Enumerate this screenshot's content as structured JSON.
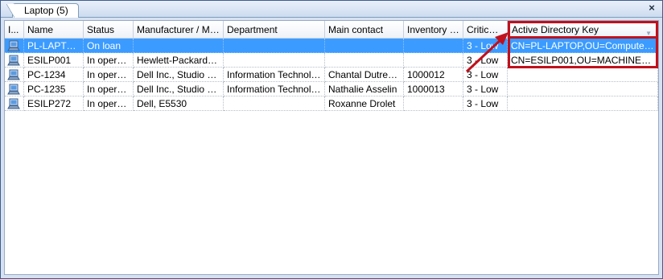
{
  "tab": {
    "label": "Laptop (5)",
    "close_glyph": "×"
  },
  "columns": [
    "I...",
    "Name",
    "Status",
    "Manufacturer / Mod...",
    "Department",
    "Main contact",
    "Inventory N...",
    "Critical...",
    "Active Directory Key"
  ],
  "rows": [
    {
      "icon": "laptop-icon",
      "name": "PL-LAPTOP",
      "status": "On loan",
      "manufacturer": "",
      "department": "",
      "contact": "",
      "inventory": "",
      "criticality": "3 - Low",
      "ad_key": "CN=PL-LAPTOP,OU=Computers t..."
    },
    {
      "icon": "laptop-icon",
      "name": "ESILP001",
      "status": "In operati...",
      "manufacturer": "Hewlett-Packard, H...",
      "department": "",
      "contact": "",
      "inventory": "",
      "criticality": "3 - Low",
      "ad_key": "CN=ESILP001,OU=MACHINES,O..."
    },
    {
      "icon": "laptop-icon",
      "name": "PC-1234",
      "status": "In operati...",
      "manufacturer": "Dell Inc., Studio 17...",
      "department": "Information Technology",
      "contact": "Chantal Dutrem...",
      "inventory": "1000012",
      "criticality": "3 - Low",
      "ad_key": ""
    },
    {
      "icon": "laptop-icon",
      "name": "PC-1235",
      "status": "In operati...",
      "manufacturer": "Dell Inc., Studio 17...",
      "department": "Information Technology",
      "contact": "Nathalie Asselin",
      "inventory": "1000013",
      "criticality": "3 - Low",
      "ad_key": ""
    },
    {
      "icon": "laptop-icon",
      "name": "ESILP272",
      "status": "In operati...",
      "manufacturer": "Dell, E5530",
      "department": "",
      "contact": "Roxanne Drolet",
      "inventory": "",
      "criticality": "3 - Low",
      "ad_key": ""
    }
  ],
  "selected_row": 0,
  "colors": {
    "selection": "#3b9bff",
    "highlight": "#c0101c",
    "frame": "#5d7aa6"
  },
  "annotation": {
    "arrow_icon": "red-arrow-icon"
  }
}
